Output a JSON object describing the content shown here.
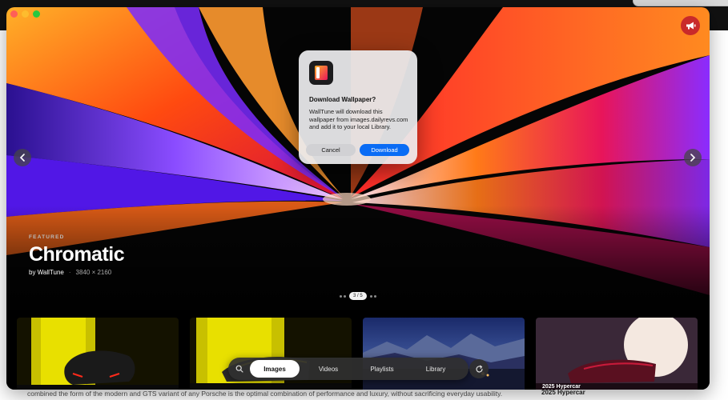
{
  "app": {
    "hero": {
      "label": "FEATURED",
      "title": "Chromatic",
      "author": "by WallTune",
      "separator": "·",
      "resolution": "3840 × 2160"
    },
    "pager": {
      "current": 3,
      "total": 5,
      "label": "3 / 5"
    },
    "tabs": [
      {
        "label": "Images",
        "active": true
      },
      {
        "label": "Videos",
        "active": false
      },
      {
        "label": "Playlists",
        "active": false
      },
      {
        "label": "Library",
        "active": false
      }
    ],
    "icons": {
      "announce": "megaphone-icon",
      "prev": "chevron-left-icon",
      "next": "chevron-right-icon",
      "search": "search-icon",
      "refresh": "refresh-icon"
    },
    "thumbnails": [
      {
        "subject": "yellow supercar rear"
      },
      {
        "subject": "yellow supercar side"
      },
      {
        "subject": "mountain landscape at dusk"
      },
      {
        "subject": "red hypercar at night",
        "caption": "2025 Hypercar"
      }
    ]
  },
  "dialog": {
    "title": "Download Wallpaper?",
    "message": "WallTune will download this wallpaper from images.dailyrevs.com and add it to your local Library.",
    "cancel_label": "Cancel",
    "confirm_label": "Download"
  },
  "background_page": {
    "text": "combined the form of the modern and GTS variant of any Porsche is the optimal combination of performance and luxury, without sacrificing everyday usability.",
    "heading": "2025 Hypercar"
  },
  "colors": {
    "accent": "#0a6cf5",
    "announce": "#c92a2a",
    "window_close": "#ff5f57",
    "window_minimize": "#febc2e",
    "window_maximize": "#28c840"
  }
}
